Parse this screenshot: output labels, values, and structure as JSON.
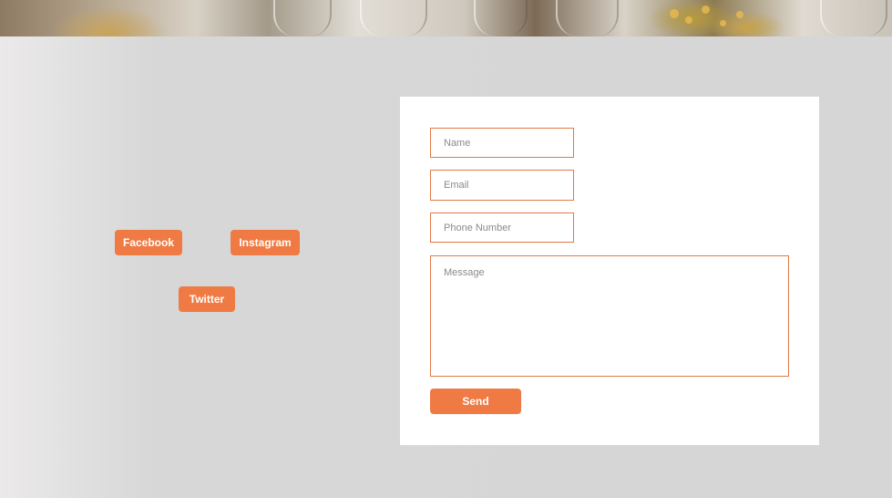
{
  "social": {
    "facebook_label": "Facebook",
    "instagram_label": "Instagram",
    "twitter_label": "Twitter"
  },
  "contact_form": {
    "name_placeholder": "Name",
    "email_placeholder": "Email",
    "phone_placeholder": "Phone Number",
    "message_placeholder": "Message",
    "send_label": "Send"
  },
  "colors": {
    "accent": "#ef7a44",
    "field_border": "#e07a45",
    "page_background": "#d6d6d6",
    "card_background": "#ffffff"
  }
}
